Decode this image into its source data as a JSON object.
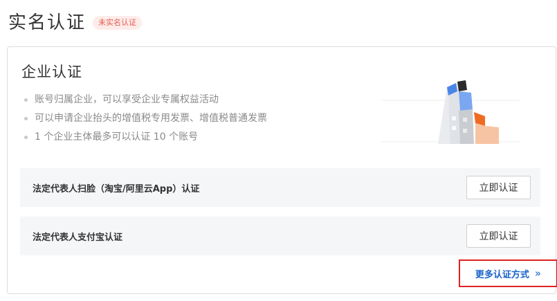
{
  "header": {
    "title": "实名认证",
    "status_badge": "未实名认证"
  },
  "card": {
    "title": "企业认证",
    "bullets": [
      "账号归属企业，可以享受企业专属权益活动",
      "可以申请企业抬头的增值税专用发票、增值税普通发票",
      "1 个企业主体最多可以认证 10 个账号"
    ],
    "methods": [
      {
        "label": "法定代表人扫脸（淘宝/阿里云App）认证",
        "button": "立即认证"
      },
      {
        "label": "法定代表人支付宝认证",
        "button": "立即认证"
      }
    ],
    "more_link": {
      "label": "更多认证方式",
      "icon": "double-chevron-right-icon"
    }
  },
  "colors": {
    "badge_text": "#e65a4e",
    "badge_bg": "#fdecea",
    "link": "#1a62c8",
    "highlight_border": "#e02020"
  }
}
